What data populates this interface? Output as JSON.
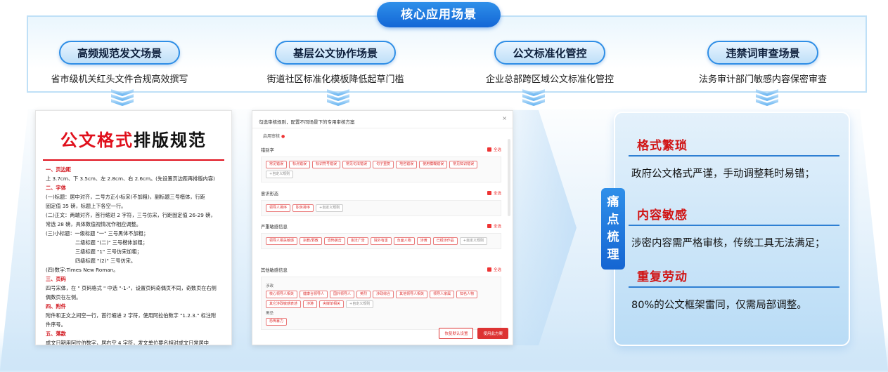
{
  "header": {
    "title": "核心应用场景"
  },
  "scenes": [
    {
      "title": "高频规范发文场景",
      "desc": "省市级机关红头文件合规高效撰写"
    },
    {
      "title": "基层公文协作场景",
      "desc": "街道社区标准化模板降低起草门槛"
    },
    {
      "title": "公文标准化管控",
      "desc": "企业总部跨区域公文标准化管控"
    },
    {
      "title": "违禁词审查场景",
      "desc": "法务审计部门敏感内容保密审查"
    }
  ],
  "doc": {
    "title_red": "公文格式",
    "title_black": "排版规范",
    "lines": [
      {
        "text": "一、页边距",
        "type": "hd"
      },
      {
        "text": "上 3.7cm、下 3.5cm、左 2.8cm、右 2.6cm。(先设置页边距再排版内容)",
        "type": "tx"
      },
      {
        "text": "二、字体",
        "type": "hd"
      },
      {
        "text": "(一)标题：居中对齐，二号方正小标宋(不加粗)，副标题三号楷体，行距",
        "type": "tx"
      },
      {
        "text": "固定值 35 磅，标题上下各空一行。",
        "type": "tx"
      },
      {
        "text": "(二)正文：两端对齐，首行缩进 2 字符，三号仿宋，行距固定值 26-29 磅，",
        "type": "tx"
      },
      {
        "text": "常选 28 磅，具体数值视情况作相应调整。",
        "type": "tx"
      },
      {
        "text": "(三)小标题：一级标题 \"一\" 三号黑体不加粗；",
        "type": "tx"
      },
      {
        "text": "二级标题 \"(二)\" 三号楷体加粗；",
        "type": "ind"
      },
      {
        "text": "三级标题 \"1\" 三号仿宋加粗；",
        "type": "ind"
      },
      {
        "text": "四级标题 \"(2)\" 三号仿宋。",
        "type": "ind"
      },
      {
        "text": "(四)数字:Times New Roman。",
        "type": "tx"
      },
      {
        "text": "三、页码",
        "type": "hd"
      },
      {
        "text": "四号宋体，在 \" 页码格式 \" 中选 \"-1-\"，设置页码奇偶页不同，奇数页在右侧",
        "type": "tx"
      },
      {
        "text": "偶数页在左侧。",
        "type": "tx"
      },
      {
        "text": "四、附件",
        "type": "hd"
      },
      {
        "text": "附件和正文之间空一行，首行缩进 2 字符，使用阿拉伯数字 \"1.2.3.\" 标注附",
        "type": "tx"
      },
      {
        "text": "件序号。",
        "type": "tx"
      },
      {
        "text": "五、落款",
        "type": "hd"
      },
      {
        "text": "成文日期用阿拉伯数字，居右空 4 字符，发文单位要名相对成文日常居中",
        "type": "tx"
      }
    ]
  },
  "panel": {
    "title": "勾选审核规则，配置不同场景下的专用审核方案",
    "close": "×",
    "sub_label": "启用审核",
    "select_all": "全选",
    "sections": [
      {
        "name": "错别字",
        "groups": [
          {
            "label": "",
            "tags": [
              "常见错误",
              "标点错误",
              "标识符号错误",
              "常见句法错误",
              "句子重复",
              "地名错误",
              "使用模糊错误",
              "常见知识错误"
            ]
          }
        ],
        "add": "+自定义规则"
      },
      {
        "name": "意识形态",
        "groups": [
          {
            "label": "",
            "tags": [
              "领导人排序",
              "职务排序"
            ]
          }
        ],
        "add": "+自定义规则"
      },
      {
        "name": "严重敏感信息",
        "groups": [
          {
            "label": "",
            "tags": [
              "领导人相关敏感",
              "宗教/邪教",
              "恐怖袭击",
              "违法广告",
              "境外有害",
              "负面人物",
              "涉黄",
              "已经涉作品"
            ]
          }
        ],
        "add": "+自定义规则"
      },
      {
        "name": "其他敏感信息",
        "groups": [
          {
            "label": "涉政",
            "tags": [
              "核心领导人相关",
              "健康合领导人",
              "国外领导人",
              "英烈",
              "涉政综合",
              "其他领导人相关",
              "领导人家属",
              "知名人物",
              "其它涉政敏感表述",
              "涉港",
              "央媒单相关"
            ]
          },
          {
            "label": "黑恐",
            "tags": [
              "恐怖暴力"
            ]
          }
        ],
        "add": "+自定义规则"
      }
    ],
    "btn_default": "恢复默认设置",
    "btn_apply": "使用此方案"
  },
  "pain": {
    "tag": "痛点梳理",
    "items": [
      {
        "title": "格式繁琐",
        "desc": "政府公文格式严谨，手动调整耗时易错；"
      },
      {
        "title": "内容敏感",
        "desc": "涉密内容需严格审核，传统工具无法满足；"
      },
      {
        "title": "重复劳动",
        "desc": "80%的公文框架雷同，仅需局部调整。"
      }
    ]
  },
  "colors": {
    "accent": "#1e7ae0",
    "red": "#d11414"
  }
}
